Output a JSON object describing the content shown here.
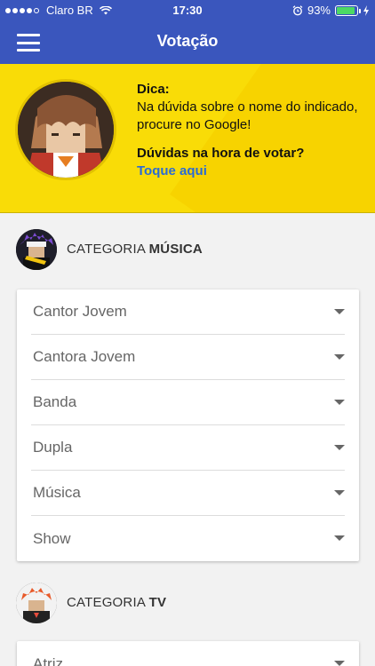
{
  "status_bar": {
    "carrier": "Claro BR",
    "time": "17:30",
    "battery": "93%",
    "battery_level": 0.93
  },
  "header": {
    "title": "Votação"
  },
  "tip": {
    "heading": "Dica:",
    "body": "Na dúvida sobre o nome do indicado, procure no Google!",
    "question": "Dúvidas na hora de votar?",
    "link": "Toque aqui"
  },
  "categories": [
    {
      "prefix": "CATEGORIA",
      "name": "MÚSICA",
      "options": [
        "Cantor Jovem",
        "Cantora Jovem",
        "Banda",
        "Dupla",
        "Música",
        "Show"
      ]
    },
    {
      "prefix": "CATEGORIA",
      "name": "TV",
      "options": [
        "Atriz"
      ]
    }
  ],
  "colors": {
    "header": "#3a56bd",
    "banner": "#f9dc07",
    "link": "#2a6bd6",
    "battery": "#4cd964"
  }
}
